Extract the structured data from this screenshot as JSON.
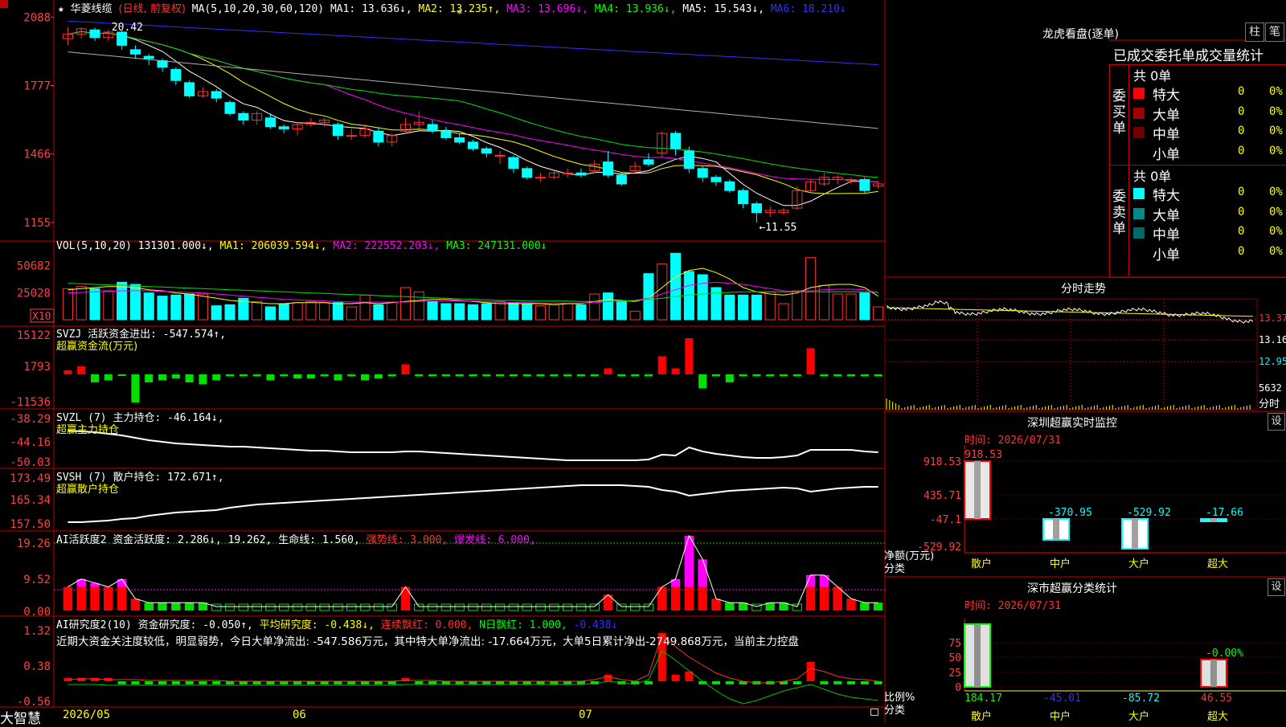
{
  "app": {
    "brand": "大智慧",
    "stock_title": "华菱线缆",
    "star_glyph": "★",
    "period_label": "(日线, 前复权)",
    "dates": {
      "d1": "2026/05",
      "d2": "06",
      "d3": "07"
    }
  },
  "colors": {
    "up": "#ff3030",
    "down": "#00ffff",
    "green": "#00e000",
    "magenta": "#ff00ff",
    "yellow": "#ffff00",
    "white": "#ffffff",
    "blue": "#3030ff",
    "gray": "#b0b0b0",
    "grid": "#990000",
    "axis_text": "#ff4040",
    "border": "#c00000"
  },
  "price_panel": {
    "ma_label": "MA(5,10,20,30,60,120)",
    "ma1": "MA1: 13.636↓,",
    "ma2": "MA2: 13.235↑,",
    "ma3": "MA3: 13.696↓,",
    "ma4": "MA4: 13.936↓,",
    "ma5": "MA5: 15.543↓,",
    "ma6": "MA6: 18.210↓",
    "yticks": [
      "2088",
      "1777",
      "1466",
      "1155"
    ],
    "high_label": "20.42",
    "low_label": "←11.55"
  },
  "volume_panel": {
    "label": "VOL(5,10,20)",
    "value": "131301.000↓,",
    "ma1": "MA1: 206039.594↓,",
    "ma2": "MA2: 222552.203↓,",
    "ma3": "MA3: 247131.000↓",
    "yticks": [
      "50682",
      "25028"
    ],
    "unit": "X10"
  },
  "svzj_panel": {
    "label": "SVZJ  活跃资金进出: -547.574↑,",
    "label2": "超赢资金流(万元)",
    "yticks": [
      "15122",
      "1793",
      "-11536"
    ]
  },
  "svzl_panel": {
    "label": "SVZL (7) 主力持仓: -46.164↓,",
    "label2": "超赢主力持仓",
    "yticks": [
      "-38.29",
      "-44.16",
      "-50.03"
    ]
  },
  "svsh_panel": {
    "label": "SVSH (7) 散户持仓: 172.671↑,",
    "label2": "超赢散户持仓",
    "yticks": [
      "173.49",
      "165.34",
      "157.50"
    ]
  },
  "ai_active_panel": {
    "l1": "AI活跃度2 资金活跃度: 2.286↓,",
    "l2": "19.262,",
    "l3": "生命线: 1.560,",
    "l4": "强势线: 3.000,",
    "l5": "爆发线: 6.000,",
    "yticks": [
      "19.26",
      "9.52",
      "0.00"
    ]
  },
  "ai_research_panel": {
    "l1": "AI研究度2(10) 资金研究度: -0.050↑,",
    "l2": "平均研究度: -0.438↓,",
    "l3": "连续飘红: 0.000,",
    "l4": "N日飘红: 1.000,",
    "l5": "-0.438↓",
    "comment": "近期大资金关注度较低，明显弱势，今日大单净流出: -547.586万元，其中特大单净流出: -17.664万元，大单5日累计净出-2749.868万元，当前主力控盘",
    "yticks": [
      "1.32",
      "0.38",
      "-0.56"
    ]
  },
  "right_panel": {
    "lhb_title": "龙虎看盘(逐单)",
    "btn_bar": "柱",
    "btn_pen": "笔",
    "header": "已成交委托单成交量统计",
    "buy_side": "委买单",
    "sell_side": "委卖单",
    "buy_total": "共 0单",
    "sell_total": "共 0单",
    "buy_rows": [
      {
        "label": "特大",
        "count": "0",
        "pct": "0%",
        "color": "#ff0000"
      },
      {
        "label": "大单",
        "count": "0",
        "pct": "0%",
        "color": "#a00000"
      },
      {
        "label": "中单",
        "count": "0",
        "pct": "0%",
        "color": "#700000"
      },
      {
        "label": "小单",
        "count": "0",
        "pct": "0%",
        "color": ""
      }
    ],
    "sell_rows": [
      {
        "label": "特大",
        "count": "0",
        "pct": "0%",
        "color": "#00ffff"
      },
      {
        "label": "大单",
        "count": "0",
        "pct": "0%",
        "color": "#008a8a"
      },
      {
        "label": "中单",
        "count": "0",
        "pct": "0%",
        "color": "#006a6a"
      },
      {
        "label": "小单",
        "count": "0",
        "pct": "0%",
        "color": ""
      }
    ],
    "intraday_title": "分时走势",
    "intraday_prices": [
      "13.37",
      "13.16",
      "12.95"
    ],
    "intraday_vol": "5632",
    "intraday_unit": "分时",
    "monitor_title": "深圳超赢实时监控",
    "monitor_set": "设",
    "monitor_time": "时间: 2026/07/31",
    "monitor_yticks": [
      "918.53",
      "435.71",
      "-47.1",
      "-529.92"
    ],
    "monitor_ylabel1": "净额(万元)",
    "monitor_ylabel2": "分类",
    "monitor_bars": [
      {
        "label": "散户",
        "value": 918.53,
        "text": "918.53"
      },
      {
        "label": "中户",
        "value": -370.95,
        "text": "-370.95"
      },
      {
        "label": "大户",
        "value": -529.92,
        "text": "-529.92"
      },
      {
        "label": "超大",
        "value": -17.66,
        "text": "-17.66"
      }
    ],
    "stats_title": "深市超赢分类统计",
    "stats_set": "设",
    "stats_time": "时间: 2026/07/31",
    "stats_yticks": [
      "75",
      "50",
      "25",
      "0"
    ],
    "stats_ylabel1": "比例%",
    "stats_ylabel2": "分类",
    "stats_note": "-0.00%",
    "stats_bars": [
      {
        "label": "散户",
        "value": 184.17,
        "text": "184.17"
      },
      {
        "label": "中户",
        "value": -45.01,
        "text": "-45.01"
      },
      {
        "label": "大户",
        "value": -85.72,
        "text": "-85.72"
      },
      {
        "label": "超大",
        "value": 46.55,
        "text": "46.55"
      }
    ]
  },
  "chart_data": {
    "type": "candlestick",
    "dates": {
      "start_label": "2026/05",
      "month_labels": [
        "06",
        "07"
      ]
    },
    "price": {
      "ylim": [
        11.0,
        21.0
      ],
      "high": 20.42,
      "low": 11.55,
      "candles": [
        [
          19.9,
          20.1,
          20.42,
          19.6
        ],
        [
          20.1,
          20.35,
          20.42,
          19.9
        ],
        [
          20.3,
          19.95,
          20.4,
          19.8
        ],
        [
          19.95,
          20.2,
          20.3,
          19.8
        ],
        [
          20.2,
          19.6,
          20.25,
          19.4
        ],
        [
          19.4,
          19.2,
          19.6,
          19.0
        ],
        [
          19.1,
          19.0,
          19.2,
          18.7
        ],
        [
          18.9,
          18.6,
          19.0,
          18.4
        ],
        [
          18.5,
          18.0,
          18.6,
          17.8
        ],
        [
          17.9,
          17.3,
          18.0,
          17.2
        ],
        [
          17.3,
          17.5,
          17.7,
          17.2
        ],
        [
          17.5,
          17.2,
          17.6,
          17.0
        ],
        [
          17.0,
          16.5,
          17.1,
          16.4
        ],
        [
          16.5,
          16.2,
          16.6,
          16.0
        ],
        [
          16.2,
          16.5,
          16.6,
          16.0
        ],
        [
          16.3,
          15.9,
          16.5,
          15.8
        ],
        [
          15.9,
          15.8,
          16.0,
          15.6
        ],
        [
          15.8,
          16.0,
          16.1,
          15.5
        ],
        [
          16.0,
          16.1,
          16.3,
          15.9
        ],
        [
          16.1,
          16.2,
          16.3,
          15.9
        ],
        [
          16.0,
          15.5,
          16.1,
          15.3
        ],
        [
          15.5,
          15.5,
          15.8,
          15.3
        ],
        [
          15.5,
          15.8,
          16.0,
          15.4
        ],
        [
          15.7,
          15.2,
          15.9,
          15.0
        ],
        [
          15.2,
          15.5,
          15.6,
          15.0
        ],
        [
          15.7,
          16.0,
          16.3,
          15.6
        ],
        [
          16.0,
          16.1,
          16.6,
          15.8
        ],
        [
          16.0,
          15.7,
          16.2,
          15.6
        ],
        [
          15.7,
          15.4,
          15.9,
          15.3
        ],
        [
          15.4,
          15.2,
          15.6,
          15.1
        ],
        [
          15.2,
          14.9,
          15.3,
          14.8
        ],
        [
          14.9,
          14.7,
          15.0,
          14.5
        ],
        [
          14.6,
          14.6,
          14.8,
          14.2
        ],
        [
          14.5,
          14.0,
          14.6,
          13.8
        ],
        [
          14.0,
          13.6,
          14.1,
          13.5
        ],
        [
          13.6,
          13.6,
          13.8,
          13.4
        ],
        [
          13.6,
          13.8,
          13.9,
          13.5
        ],
        [
          13.8,
          13.8,
          14.0,
          13.6
        ],
        [
          13.8,
          13.7,
          14.0,
          13.6
        ],
        [
          13.9,
          14.2,
          14.4,
          13.8
        ],
        [
          14.3,
          13.7,
          14.8,
          13.6
        ],
        [
          13.7,
          13.3,
          13.8,
          13.2
        ],
        [
          13.9,
          14.1,
          14.3,
          13.8
        ],
        [
          14.4,
          14.2,
          14.7,
          14.1
        ],
        [
          14.7,
          15.6,
          15.7,
          14.5
        ],
        [
          15.6,
          14.9,
          15.7,
          14.6
        ],
        [
          14.8,
          14.0,
          15.0,
          13.8
        ],
        [
          14.0,
          13.6,
          14.1,
          13.4
        ],
        [
          13.6,
          13.4,
          13.7,
          13.2
        ],
        [
          13.4,
          13.0,
          13.5,
          12.9
        ],
        [
          13.0,
          12.4,
          13.1,
          12.2
        ],
        [
          12.4,
          12.0,
          12.5,
          11.55
        ],
        [
          12.0,
          12.1,
          12.3,
          11.8
        ],
        [
          12.0,
          12.1,
          12.2,
          11.9
        ],
        [
          12.2,
          13.0,
          13.2,
          12.1
        ],
        [
          13.0,
          13.4,
          13.5,
          12.9
        ],
        [
          13.3,
          13.6,
          13.8,
          13.2
        ],
        [
          13.5,
          13.6,
          13.7,
          13.3
        ],
        [
          13.5,
          13.5,
          13.6,
          13.3
        ],
        [
          13.5,
          13.0,
          13.6,
          12.9
        ],
        [
          13.2,
          13.3,
          13.4,
          13.1
        ]
      ]
    },
    "volume": {
      "ylim": [
        0,
        60000
      ],
      "values": [
        29000,
        31000,
        29000,
        27000,
        35000,
        33000,
        25000,
        22000,
        23000,
        24000,
        24000,
        13000,
        14000,
        20000,
        17000,
        12000,
        15000,
        16000,
        17000,
        16000,
        16000,
        12000,
        23000,
        14000,
        16000,
        30000,
        26000,
        17000,
        15000,
        15000,
        14000,
        15000,
        17000,
        16000,
        15000,
        13000,
        14000,
        15000,
        14000,
        24000,
        25000,
        17000,
        8000,
        43000,
        52000,
        62000,
        45000,
        42000,
        30000,
        23000,
        23000,
        23000,
        26000,
        15000,
        27000,
        58000,
        32000,
        24000,
        24000,
        25000,
        12000
      ],
      "ma": {
        "ma1": [
          28000,
          29000,
          30000,
          31000,
          31000,
          30000,
          28000,
          27000,
          25000,
          24000,
          22000,
          20000,
          18000,
          17000,
          16000,
          15000,
          15000,
          16000,
          16000,
          16000,
          15000,
          15000,
          16000,
          15000,
          16000,
          17000,
          18000,
          19000,
          19000,
          18000,
          17000,
          16000,
          15000,
          15000,
          15000,
          15000,
          14000,
          15000,
          15000,
          17000,
          19000,
          18000,
          17000,
          20000,
          30000,
          40000,
          46000,
          48000,
          44000,
          38000,
          30000,
          26000,
          24000,
          23000,
          25000,
          30000,
          32000,
          33000,
          33000,
          30000,
          22000
        ],
        "ma2": [
          25000,
          25500,
          26000,
          26500,
          27000,
          27000,
          27000,
          26500,
          26000,
          25500,
          25000,
          24000,
          23000,
          22000,
          21000,
          20000,
          19000,
          18500,
          18000,
          17500,
          17000,
          16500,
          16500,
          16500,
          16500,
          16500,
          17000,
          17500,
          17500,
          17500,
          17500,
          17000,
          16500,
          16000,
          16000,
          15500,
          15500,
          15500,
          15500,
          16000,
          17000,
          17500,
          18000,
          20000,
          24000,
          28000,
          32000,
          34000,
          35000,
          34000,
          33000,
          31000,
          29000,
          27000,
          26000,
          27000,
          28000,
          28500,
          28500,
          28000,
          25000
        ],
        "ma3": [
          34000,
          33500,
          33000,
          32500,
          32000,
          31500,
          31000,
          30500,
          30000,
          29500,
          29000,
          28500,
          28000,
          27500,
          27000,
          26500,
          26000,
          25500,
          25000,
          24500,
          24000,
          23500,
          23000,
          22500,
          22000,
          21500,
          21000,
          20500,
          20000,
          19500,
          19000,
          18500,
          18000,
          18000,
          17500,
          17500,
          17500,
          17500,
          17000,
          17000,
          17000,
          17500,
          18000,
          19000,
          20000,
          21500,
          23000,
          24000,
          25000,
          25500,
          26000,
          26000,
          26000,
          26000,
          26000,
          26000,
          26000,
          26000,
          26000,
          26000,
          25500
        ]
      }
    }
  }
}
